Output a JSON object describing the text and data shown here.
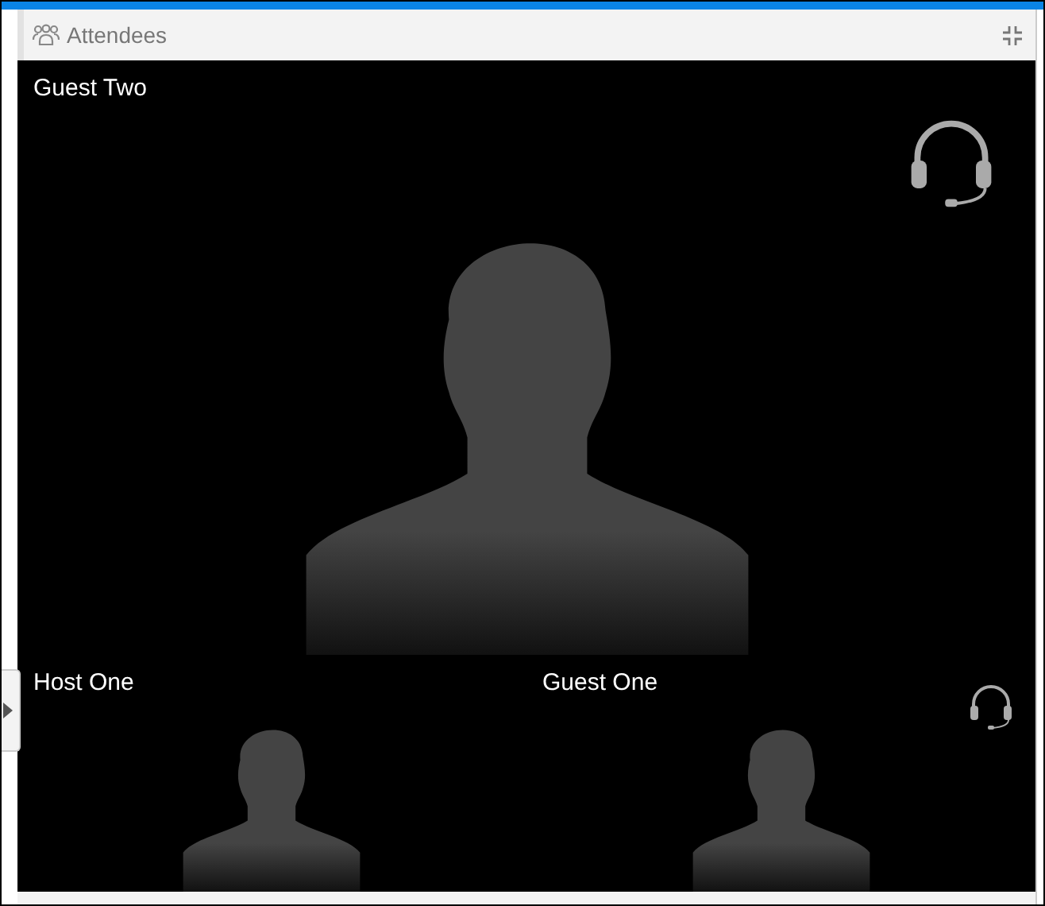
{
  "panel": {
    "title": "Attendees"
  },
  "tiles": [
    {
      "kind": "main",
      "name": "Guest Two",
      "headset": true
    },
    {
      "kind": "thumb",
      "name": "Host One",
      "headset": false
    },
    {
      "kind": "thumb",
      "name": "Guest One",
      "headset": true
    }
  ]
}
